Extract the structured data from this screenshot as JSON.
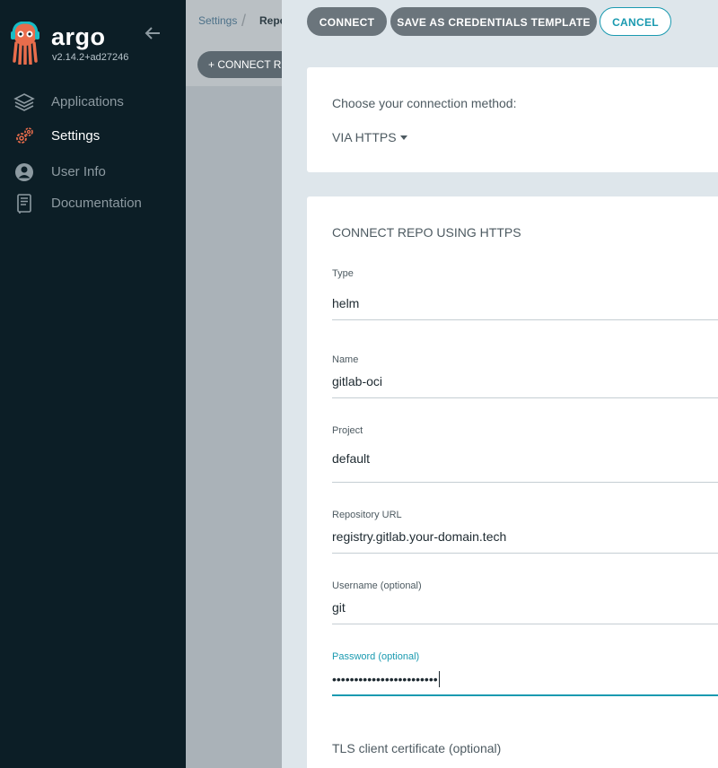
{
  "sidebar": {
    "brand": "argo",
    "version": "v2.14.2+ad27246",
    "items": [
      {
        "label": "Applications",
        "icon": "layers-icon",
        "active": false
      },
      {
        "label": "Settings",
        "icon": "gears-icon",
        "active": true
      },
      {
        "label": "User Info",
        "icon": "user-icon",
        "active": false
      },
      {
        "label": "Documentation",
        "icon": "book-icon",
        "active": false
      }
    ]
  },
  "background_page": {
    "breadcrumb": [
      "Settings",
      "Repositories"
    ],
    "connect_button": "+ CONNECT REPO"
  },
  "toolbar": {
    "connect_label": "CONNECT",
    "save_template_label": "SAVE AS CREDENTIALS TEMPLATE",
    "cancel_label": "CANCEL"
  },
  "method": {
    "prompt": "Choose your connection method:",
    "value": "VIA HTTPS"
  },
  "form": {
    "title": "CONNECT REPO USING HTTPS",
    "type": {
      "label": "Type",
      "value": "helm"
    },
    "name": {
      "label": "Name",
      "value": "gitlab-oci"
    },
    "project": {
      "label": "Project",
      "value": "default"
    },
    "repo_url": {
      "label": "Repository URL",
      "value": "registry.gitlab.your-domain.tech"
    },
    "username": {
      "label": "Username (optional)",
      "value": "git"
    },
    "password": {
      "label": "Password (optional)",
      "value": "••••••••••••••••••••••••"
    },
    "tls_label": "TLS client certificate (optional)"
  },
  "colors": {
    "sidebar_bg": "#0c1e26",
    "accent": "#1a9ab0",
    "panel_bg": "#dee6eb"
  }
}
